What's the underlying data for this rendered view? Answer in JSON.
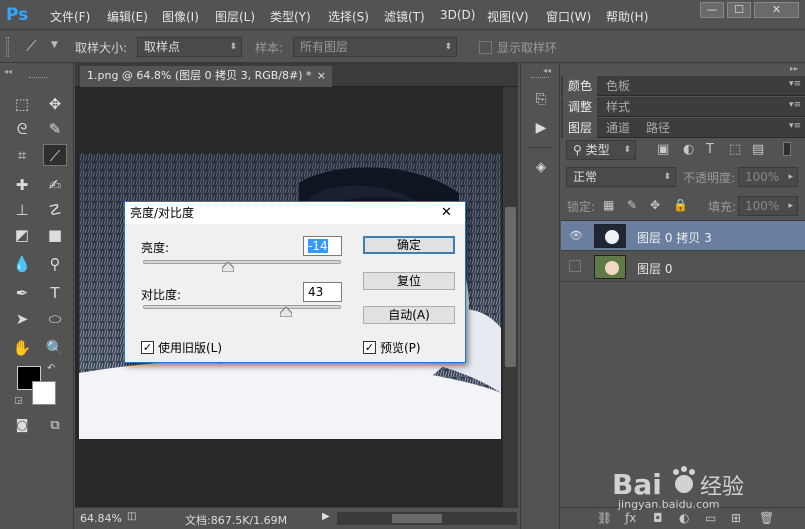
{
  "app": {
    "logo": "Ps"
  },
  "menu": [
    "文件(F)",
    "编辑(E)",
    "图像(I)",
    "图层(L)",
    "类型(Y)",
    "选择(S)",
    "滤镜(T)",
    "3D(D)",
    "视图(V)",
    "窗口(W)",
    "帮助(H)"
  ],
  "window_controls": {
    "minimize": "—",
    "maximize": "☐",
    "close": "✕"
  },
  "options": {
    "sample_size_label": "取样大小:",
    "sample_size_value": "取样点",
    "sample_label": "样本:",
    "sample_value": "所有图层",
    "show_ring_label": "显示取样环"
  },
  "document": {
    "tab_title": "1.png @ 64.8% (图层 0 拷贝 3, RGB/8#) *",
    "tab_close": "×",
    "zoom": "64.84%",
    "doc_info": "文档:867.5K/1.69M"
  },
  "dialog": {
    "title": "亮度/对比度",
    "close": "✕",
    "brightness_label": "亮度:",
    "brightness_value": "-14",
    "contrast_label": "对比度:",
    "contrast_value": "43",
    "ok_button": "确定",
    "reset_button": "复位",
    "auto_button": "自动(A)",
    "legacy_label": "使用旧版(L)",
    "legacy_checked": true,
    "preview_label": "预览(P)",
    "preview_checked": true,
    "brightness_fraction": 0.43,
    "contrast_fraction": 0.72
  },
  "panels": {
    "group1_tabs": [
      "颜色",
      "色板"
    ],
    "group2_tabs": [
      "调整",
      "样式"
    ],
    "group3_tabs": [
      "图层",
      "通道",
      "路径"
    ],
    "filter_kind": "类型",
    "blend_mode": "正常",
    "opacity_label": "不透明度:",
    "opacity_value": "100%",
    "lock_label": "锁定:",
    "fill_label": "填充:",
    "fill_value": "100%"
  },
  "layers": [
    {
      "name": "图层 0 拷贝 3",
      "visible": true,
      "selected": true
    },
    {
      "name": "图层 0",
      "visible": false,
      "selected": false
    }
  ],
  "colors": {
    "accent": "#31a8ff",
    "selected_layer": "#6a7fa0"
  }
}
